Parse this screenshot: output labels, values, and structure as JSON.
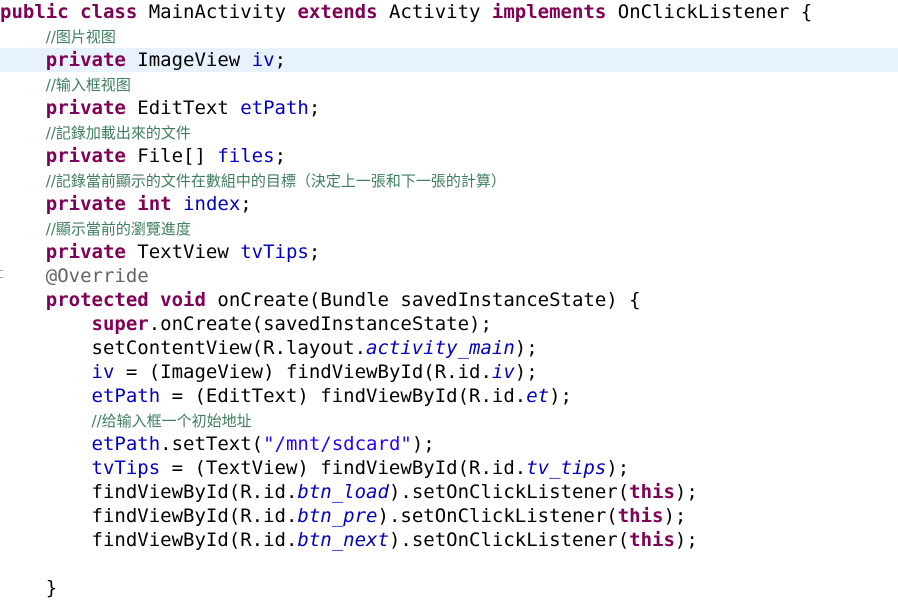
{
  "colors": {
    "background": "#ffffff",
    "keyword": "#7f0055",
    "field": "#0000c0",
    "comment": "#3f7f5f",
    "string": "#2a00ff",
    "annotation": "#646464",
    "current_line": "#e8f2fe"
  },
  "highlighted_line": 2,
  "lines": [
    [
      {
        "t": "public",
        "c": "kw"
      },
      {
        "t": " "
      },
      {
        "t": "class",
        "c": "kw"
      },
      {
        "t": " MainActivity "
      },
      {
        "t": "extends",
        "c": "kw"
      },
      {
        "t": " Activity "
      },
      {
        "t": "implements",
        "c": "kw"
      },
      {
        "t": " OnClickListener {"
      }
    ],
    [
      {
        "t": "    "
      },
      {
        "t": "//图片视图",
        "c": "cm"
      }
    ],
    [
      {
        "t": "    "
      },
      {
        "t": "private",
        "c": "kw"
      },
      {
        "t": " ImageView "
      },
      {
        "t": "iv",
        "c": "fld"
      },
      {
        "t": ";"
      }
    ],
    [
      {
        "t": "    "
      },
      {
        "t": "//输入框视图",
        "c": "cm"
      }
    ],
    [
      {
        "t": "    "
      },
      {
        "t": "private",
        "c": "kw"
      },
      {
        "t": " EditText "
      },
      {
        "t": "etPath",
        "c": "fld"
      },
      {
        "t": ";"
      }
    ],
    [
      {
        "t": "    "
      },
      {
        "t": "//記錄加載出來的文件",
        "c": "cm"
      }
    ],
    [
      {
        "t": "    "
      },
      {
        "t": "private",
        "c": "kw"
      },
      {
        "t": " File[] "
      },
      {
        "t": "files",
        "c": "fld"
      },
      {
        "t": ";"
      }
    ],
    [
      {
        "t": "    "
      },
      {
        "t": "//記錄當前顯示的文件在數組中的目標（決定上一張和下一張的計算）",
        "c": "cm"
      }
    ],
    [
      {
        "t": "    "
      },
      {
        "t": "private",
        "c": "kw"
      },
      {
        "t": " "
      },
      {
        "t": "int",
        "c": "kw"
      },
      {
        "t": " "
      },
      {
        "t": "index",
        "c": "fld"
      },
      {
        "t": ";"
      }
    ],
    [
      {
        "t": "    "
      },
      {
        "t": "//顯示當前的瀏覽進度",
        "c": "cm"
      }
    ],
    [
      {
        "t": "    "
      },
      {
        "t": "private",
        "c": "kw"
      },
      {
        "t": " TextView "
      },
      {
        "t": "tvTips",
        "c": "fld"
      },
      {
        "t": ";"
      }
    ],
    [
      {
        "t": "    "
      },
      {
        "t": "@Override",
        "c": "ann"
      }
    ],
    [
      {
        "t": "    "
      },
      {
        "t": "protected",
        "c": "kw"
      },
      {
        "t": " "
      },
      {
        "t": "void",
        "c": "kw"
      },
      {
        "t": " onCreate(Bundle savedInstanceState) {"
      }
    ],
    [
      {
        "t": "        "
      },
      {
        "t": "super",
        "c": "kw"
      },
      {
        "t": ".onCreate(savedInstanceState);"
      }
    ],
    [
      {
        "t": "        setContentView(R.layout."
      },
      {
        "t": "activity_main",
        "c": "st"
      },
      {
        "t": ");"
      }
    ],
    [
      {
        "t": "        "
      },
      {
        "t": "iv",
        "c": "fld"
      },
      {
        "t": " = (ImageView) findViewById(R.id."
      },
      {
        "t": "iv",
        "c": "st"
      },
      {
        "t": ");"
      }
    ],
    [
      {
        "t": "        "
      },
      {
        "t": "etPath",
        "c": "fld"
      },
      {
        "t": " = (EditText) findViewById(R.id."
      },
      {
        "t": "et",
        "c": "st"
      },
      {
        "t": ");"
      }
    ],
    [
      {
        "t": "        "
      },
      {
        "t": "//给输入框一个初始地址",
        "c": "cm"
      }
    ],
    [
      {
        "t": "        "
      },
      {
        "t": "etPath",
        "c": "fld"
      },
      {
        "t": ".setText("
      },
      {
        "t": "\"/mnt/sdcard\"",
        "c": "str"
      },
      {
        "t": ");"
      }
    ],
    [
      {
        "t": "        "
      },
      {
        "t": "tvTips",
        "c": "fld"
      },
      {
        "t": " = (TextView) findViewById(R.id."
      },
      {
        "t": "tv_tips",
        "c": "st"
      },
      {
        "t": ");"
      }
    ],
    [
      {
        "t": "        findViewById(R.id."
      },
      {
        "t": "btn_load",
        "c": "st"
      },
      {
        "t": ").setOnClickListener("
      },
      {
        "t": "this",
        "c": "kw"
      },
      {
        "t": ");"
      }
    ],
    [
      {
        "t": "        findViewById(R.id."
      },
      {
        "t": "btn_pre",
        "c": "st"
      },
      {
        "t": ").setOnClickListener("
      },
      {
        "t": "this",
        "c": "kw"
      },
      {
        "t": ");"
      }
    ],
    [
      {
        "t": "        findViewById(R.id."
      },
      {
        "t": "btn_next",
        "c": "st"
      },
      {
        "t": ").setOnClickListener("
      },
      {
        "t": "this",
        "c": "kw"
      },
      {
        "t": ");"
      }
    ],
    [
      {
        "t": ""
      }
    ],
    [
      {
        "t": "    }"
      }
    ]
  ]
}
